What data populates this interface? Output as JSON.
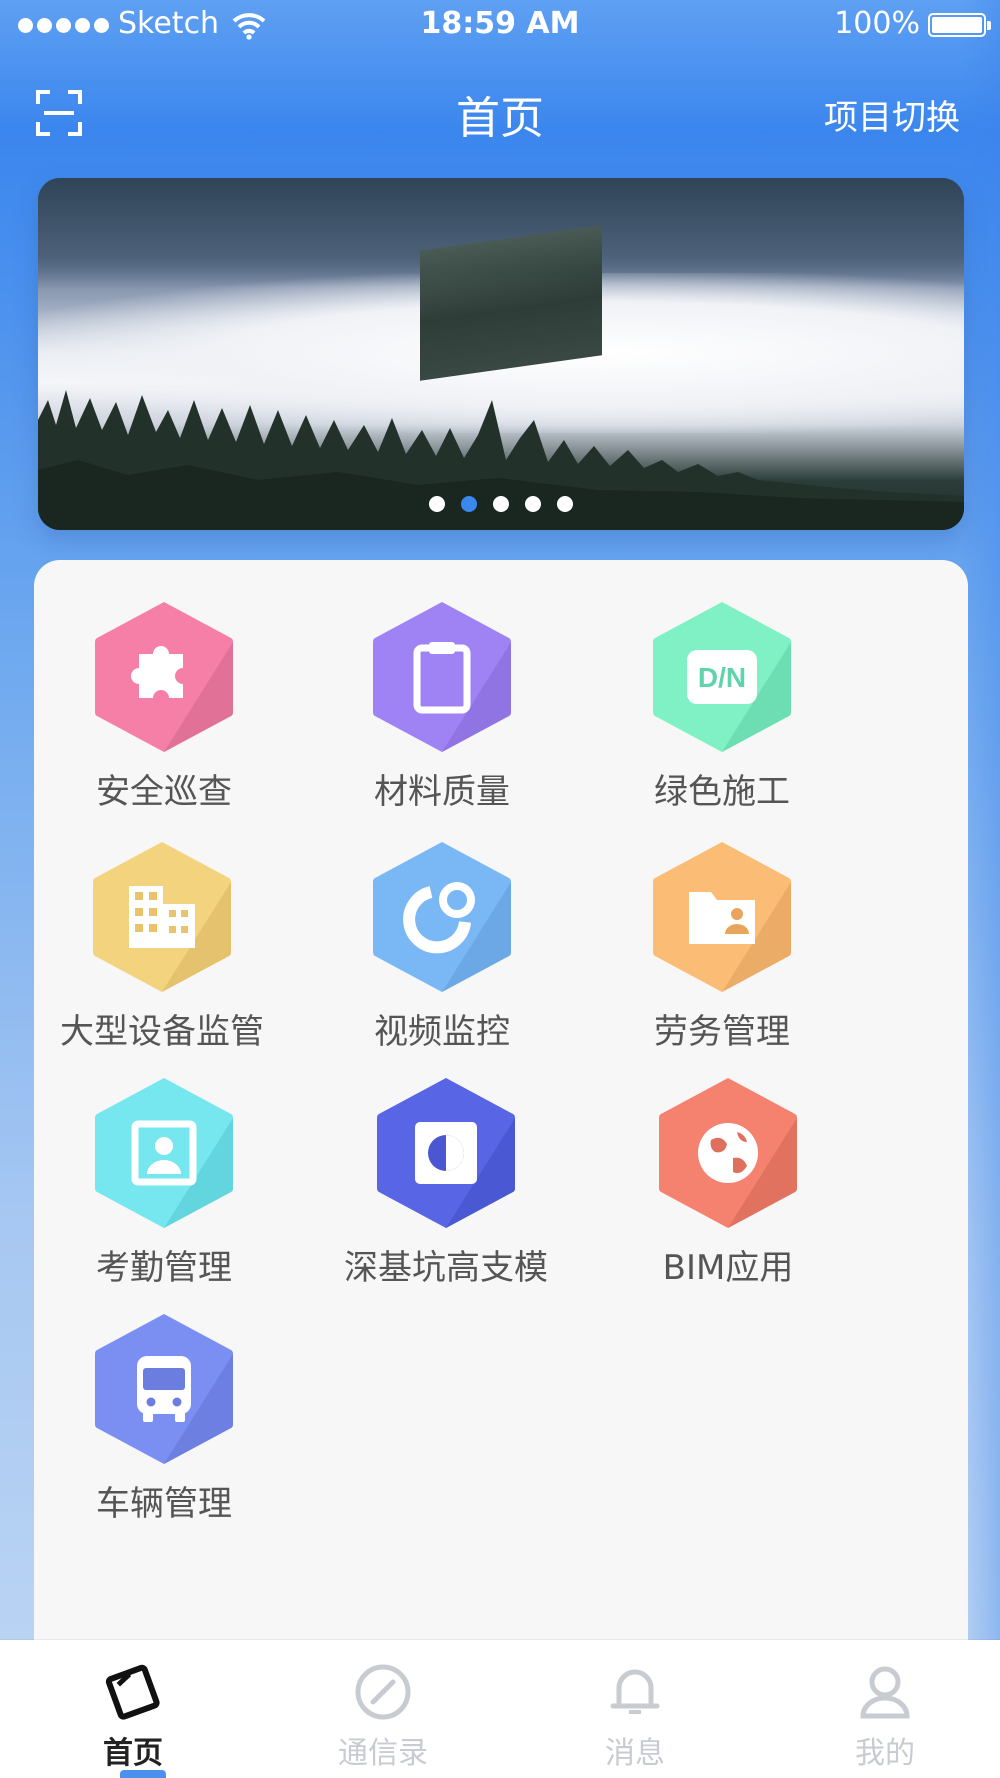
{
  "status_bar": {
    "carrier": "Sketch",
    "time": "18:59 AM",
    "battery": "100%"
  },
  "nav": {
    "title": "首页",
    "switch_label": "项目切换",
    "scan_icon": "scan-icon"
  },
  "banner": {
    "page_count": 5,
    "active_index": 1
  },
  "modules": [
    {
      "label": "安全巡查",
      "icon": "puzzle-icon",
      "color": "#f57fa6",
      "shade": "#e07096"
    },
    {
      "label": "材料质量",
      "icon": "clipboard-icon",
      "color": "#9f83f4",
      "shade": "#8f72e2"
    },
    {
      "label": "绿色施工",
      "icon": "dn-icon",
      "color": "#7ff1c4",
      "shade": "#6bdcb1",
      "icon_text": "D/N"
    },
    {
      "label": "大型设备监管",
      "icon": "building-icon",
      "color": "#f4d37f",
      "shade": "#e2c06d"
    },
    {
      "label": "视频监控",
      "icon": "camera-icon",
      "color": "#7ab8f5",
      "shade": "#6aa6e3"
    },
    {
      "label": "劳务管理",
      "icon": "folder-person-icon",
      "color": "#fbbd76",
      "shade": "#e8aa66"
    },
    {
      "label": "考勤管理",
      "icon": "contact-card-icon",
      "color": "#76e6ef",
      "shade": "#62d3dd"
    },
    {
      "label": "深基坑高支模",
      "icon": "contrast-icon",
      "color": "#5866e6",
      "shade": "#4a56d2"
    },
    {
      "label": "BIM应用",
      "icon": "globe-icon",
      "color": "#f4826f",
      "shade": "#e0705e"
    },
    {
      "label": "车辆管理",
      "icon": "bus-icon",
      "color": "#7b8ef2",
      "shade": "#6b7ddf"
    }
  ],
  "tabs": [
    {
      "label": "首页",
      "icon": "home-card-icon",
      "active": true
    },
    {
      "label": "通信录",
      "icon": "compass-icon",
      "active": false
    },
    {
      "label": "消息",
      "icon": "bell-icon",
      "active": false
    },
    {
      "label": "我的",
      "icon": "user-icon",
      "active": false
    }
  ],
  "colors": {
    "accent": "#3a88ee",
    "tab_inactive": "#c8cbd1",
    "card_bg": "#f7f7f7"
  }
}
